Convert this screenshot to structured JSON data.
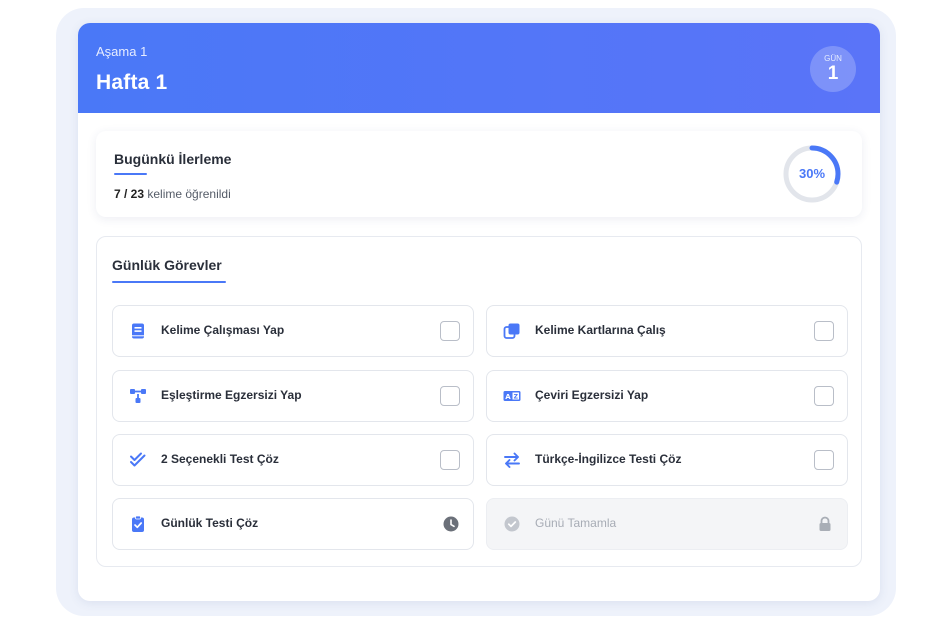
{
  "header": {
    "stage": "Aşama 1",
    "week": "Hafta 1",
    "day_label": "GÜN",
    "day_number": "1"
  },
  "progress": {
    "title": "Bugünkü İlerleme",
    "learned": "7 / 23",
    "suffix": " kelime öğrenildi",
    "percent_text": "30%",
    "percent_value": 30,
    "accent_color": "#4a78f7"
  },
  "tasks": {
    "title": "Günlük Görevler",
    "items": [
      {
        "label": "Kelime Çalışması Yap",
        "icon": "book-icon",
        "checked": false
      },
      {
        "label": "Kelime Kartlarına Çalış",
        "icon": "cards-icon",
        "checked": false
      },
      {
        "label": "Eşleştirme Egzersizi Yap",
        "icon": "matching-icon",
        "checked": false
      },
      {
        "label": "Çeviri Egzersizi Yap",
        "icon": "translate-icon",
        "checked": false
      },
      {
        "label": "2 Seçenekli Test Çöz",
        "icon": "double-check-icon",
        "checked": false
      },
      {
        "label": "Türkçe-İngilizce Testi Çöz",
        "icon": "swap-arrows-icon",
        "checked": false
      },
      {
        "label": "Günlük Testi Çöz",
        "icon": "clipboard-check-icon",
        "status": "clock-icon"
      },
      {
        "label": "Günü Tamamla",
        "icon": "check-circle-icon",
        "status": "lock-icon",
        "locked": true
      }
    ]
  }
}
